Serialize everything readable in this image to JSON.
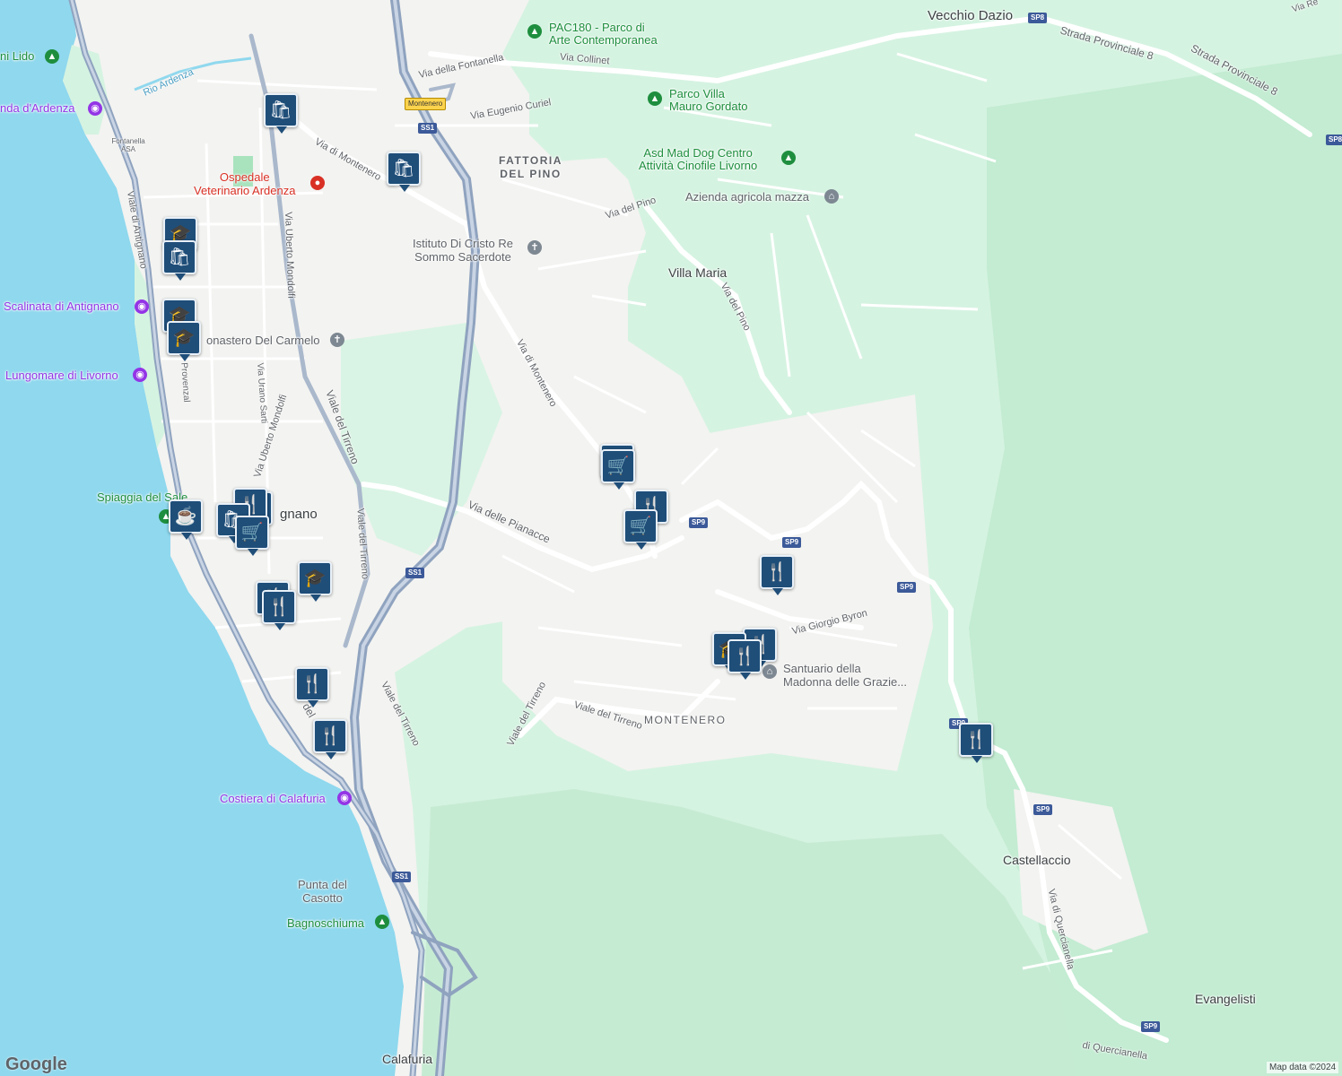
{
  "map": {
    "attribution": "Map data ©2024",
    "logo": "Google",
    "places": [
      {
        "id": "vecchio-dazio",
        "text": "Vecchio Dazio"
      },
      {
        "id": "villa-maria",
        "text": "Villa Maria"
      },
      {
        "id": "castellaccio",
        "text": "Castellaccio"
      },
      {
        "id": "evangelisti",
        "text": "Evangelisti"
      },
      {
        "id": "calafuria",
        "text": "Calafuria"
      },
      {
        "id": "antignano",
        "text": "gnano"
      }
    ],
    "districts": [
      {
        "id": "fattoria-del-pino",
        "line1": "FATTORIA",
        "line2": "DEL PINO"
      },
      {
        "id": "montenero",
        "line1": "MONTENERO",
        "line2": ""
      }
    ],
    "pois": [
      {
        "id": "pac180",
        "line1": "PAC180 - Parco di",
        "line2": "Arte Contemporanea",
        "icon": "tree-icon",
        "color": "green"
      },
      {
        "id": "parco-villa",
        "line1": "Parco Villa",
        "line2": "Mauro Gordato",
        "icon": "tree-icon",
        "color": "green"
      },
      {
        "id": "asd-mad-dog",
        "line1": "Asd Mad Dog Centro",
        "line2": "Attività Cinofile Livorno",
        "icon": "tree-icon",
        "color": "green"
      },
      {
        "id": "azienda",
        "line1": "Azienda agricola mazza",
        "line2": "",
        "icon": "museum-icon",
        "color": "gray"
      },
      {
        "id": "istituto",
        "line1": "Istituto Di Cristo Re",
        "line2": "Sommo Sacerdote",
        "icon": "cross-icon",
        "color": "gray"
      },
      {
        "id": "monastero",
        "line1": "onastero Del Carmelo",
        "line2": "",
        "icon": "cross-icon",
        "color": "gray"
      },
      {
        "id": "ospedale",
        "line1": "Ospedale",
        "line2": "Veterinario Ardenza",
        "icon": "pin-icon",
        "color": "red"
      },
      {
        "id": "santuario",
        "line1": "Santuario della",
        "line2": "Madonna delle Grazie...",
        "icon": "museum-icon",
        "color": "gray"
      },
      {
        "id": "lido",
        "line1": "ni Lido",
        "line2": "",
        "icon": "tree-icon",
        "color": "green"
      },
      {
        "id": "ardenza",
        "line1": "nda d'Ardenza",
        "line2": "",
        "icon": "camera-icon",
        "color": "purple"
      },
      {
        "id": "scalinata",
        "line1": "Scalinata di Antignano",
        "line2": "",
        "icon": "camera-icon",
        "color": "purple"
      },
      {
        "id": "lungomare",
        "line1": "Lungomare di Livorno",
        "line2": "",
        "icon": "camera-icon",
        "color": "purple"
      },
      {
        "id": "spiaggia",
        "line1": "Spiaggia del Sale",
        "line2": "",
        "icon": "tree-icon",
        "color": "green"
      },
      {
        "id": "costiera",
        "line1": "Costiera di Calafuria",
        "line2": "",
        "icon": "camera-icon",
        "color": "purple"
      },
      {
        "id": "punta",
        "line1": "Punta del",
        "line2": "Casotto",
        "icon": "",
        "color": "gray"
      },
      {
        "id": "bagnoschiuma",
        "line1": "Bagnoschiuma",
        "line2": "",
        "icon": "tree-icon",
        "color": "green"
      }
    ],
    "roads": [
      {
        "id": "via-fontanella",
        "text": "Via della Fontanella"
      },
      {
        "id": "via-collinet",
        "text": "Via Collinet"
      },
      {
        "id": "via-curiel",
        "text": "Via Eugenio Curiel"
      },
      {
        "id": "via-montenero-1",
        "text": "Via di Montenero"
      },
      {
        "id": "via-montenero-2",
        "text": "Via di Montenero"
      },
      {
        "id": "via-pino-1",
        "text": "Via del Pino"
      },
      {
        "id": "via-pino-2",
        "text": "Via del Pino"
      },
      {
        "id": "via-mondolfi-1",
        "text": "Via Uberto Mondolfi"
      },
      {
        "id": "via-mondolfi-2",
        "text": "Via Uberto Mondolfi"
      },
      {
        "id": "viale-tirreno-1",
        "text": "Viale del Tirreno"
      },
      {
        "id": "viale-tirreno-2",
        "text": "Viale del Tirreno"
      },
      {
        "id": "viale-tirreno-3",
        "text": "Viale del Tirreno"
      },
      {
        "id": "viale-tirreno-4",
        "text": "Viale del Tirreno"
      },
      {
        "id": "viale-tirreno-5",
        "text": "Viale del Tirreno"
      },
      {
        "id": "via-pianacce",
        "text": "Via delle Pianacce"
      },
      {
        "id": "viale-antignano",
        "text": "Viale di Antignano"
      },
      {
        "id": "via-sarti",
        "text": "Via Urano Sarti"
      },
      {
        "id": "provenzal",
        "text": "Provenzal"
      },
      {
        "id": "via-byron",
        "text": "Via Giorgio Byron"
      },
      {
        "id": "via-quercianella-1",
        "text": "Via di Quercianella"
      },
      {
        "id": "via-quercianella-2",
        "text": "di Quercianella"
      },
      {
        "id": "strada-prov-1",
        "text": "Strada Provinciale 8"
      },
      {
        "id": "strada-prov-2",
        "text": "Strada Provinciale 8"
      },
      {
        "id": "rio-ardenza",
        "text": "Rio Ardenza"
      },
      {
        "id": "fontanella-asa",
        "text": "Fontanella ASA"
      },
      {
        "id": "via-re",
        "text": "Via Re"
      },
      {
        "id": "del",
        "text": "del"
      }
    ],
    "shields": [
      {
        "id": "ss1-a",
        "text": "SS1"
      },
      {
        "id": "ss1-b",
        "text": "SS1"
      },
      {
        "id": "ss1-c",
        "text": "SS1"
      },
      {
        "id": "sp8-a",
        "text": "SP8"
      },
      {
        "id": "sp8-b",
        "text": "SP8"
      },
      {
        "id": "sp9-a",
        "text": "SP9"
      },
      {
        "id": "sp9-b",
        "text": "SP9"
      },
      {
        "id": "sp9-c",
        "text": "SP9"
      },
      {
        "id": "sp9-d",
        "text": "SP9"
      },
      {
        "id": "sp9-e",
        "text": "SP9"
      },
      {
        "id": "sp9-f",
        "text": "SP9"
      },
      {
        "id": "montenero-sign",
        "text": "Montenero"
      }
    ],
    "markers": [
      {
        "id": "m1",
        "icon": "shopping-bag-icon",
        "glyph": "🛍"
      },
      {
        "id": "m2",
        "icon": "shopping-bag-icon",
        "glyph": "🛍"
      },
      {
        "id": "m3",
        "icon": "graduation-cap-icon",
        "glyph": "🎓"
      },
      {
        "id": "m4",
        "icon": "shopping-bag-icon",
        "glyph": "🛍"
      },
      {
        "id": "m5",
        "icon": "graduation-cap-icon",
        "glyph": "🎓"
      },
      {
        "id": "m6",
        "icon": "graduation-cap-icon",
        "glyph": "🎓"
      },
      {
        "id": "m7",
        "icon": "shopping-cart-icon",
        "glyph": "🛒"
      },
      {
        "id": "m8",
        "icon": "shopping-cart-icon",
        "glyph": "🛒"
      },
      {
        "id": "m9",
        "icon": "restaurant-icon",
        "glyph": "🍴"
      },
      {
        "id": "m10",
        "icon": "shopping-cart-icon",
        "glyph": "🛒"
      },
      {
        "id": "m11",
        "icon": "restaurant-icon",
        "glyph": "🍴"
      },
      {
        "id": "m12",
        "icon": "coffee-icon",
        "glyph": "☕"
      },
      {
        "id": "m13",
        "icon": "restaurant-icon",
        "glyph": "🍴"
      },
      {
        "id": "m14",
        "icon": "shopping-bag-icon",
        "glyph": "🛍"
      },
      {
        "id": "m15",
        "icon": "shopping-cart-icon",
        "glyph": "🛒"
      },
      {
        "id": "m16",
        "icon": "graduation-cap-icon",
        "glyph": "🎓"
      },
      {
        "id": "m17",
        "icon": "restaurant-icon",
        "glyph": "🍴"
      },
      {
        "id": "m18",
        "icon": "restaurant-icon",
        "glyph": "🍴"
      },
      {
        "id": "m19",
        "icon": "restaurant-icon",
        "glyph": "🍴"
      },
      {
        "id": "m20",
        "icon": "restaurant-icon",
        "glyph": "🍴"
      },
      {
        "id": "m21",
        "icon": "graduation-cap-icon",
        "glyph": "🎓"
      },
      {
        "id": "m22",
        "icon": "restaurant-icon",
        "glyph": "🍴"
      },
      {
        "id": "m23",
        "icon": "restaurant-icon",
        "glyph": "🍴"
      },
      {
        "id": "m24",
        "icon": "restaurant-icon",
        "glyph": "🍴"
      }
    ],
    "colors": {
      "sea": "#8fd8ee",
      "land": "#f3f3f1",
      "park": "#ccefdc",
      "forest": "#b7e5c8",
      "road": "#ffffff",
      "highway": "#8fa3bf",
      "marker": "#1f4e79"
    }
  }
}
